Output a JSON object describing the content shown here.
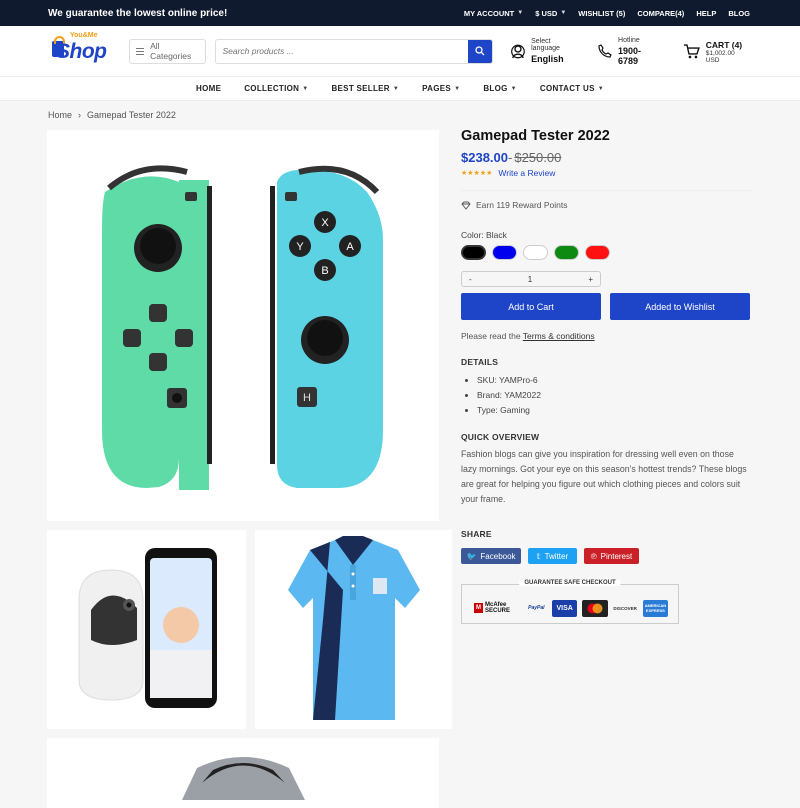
{
  "topbar": {
    "promo": "We guarantee the lowest online price!",
    "links": [
      "MY ACCOUNT",
      "$ USD",
      "WISHLIST (5)",
      "COMPARE(4)",
      "HELP",
      "BLOG"
    ]
  },
  "header": {
    "logo_top": "You&Me",
    "logo_main": "Shop",
    "categories_label": "All Categories",
    "search_placeholder": "Search products ...",
    "language_label": "Select language",
    "language_value": "English",
    "hotline_label": "Hotline",
    "hotline_value": "1900-6789",
    "cart_label": "CART (4)",
    "cart_total": "$1,002.00 USD"
  },
  "nav": [
    "HOME",
    "COLLECTION",
    "BEST SELLER",
    "PAGES",
    "BLOG",
    "CONTACT US"
  ],
  "breadcrumb": {
    "home": "Home",
    "current": "Gamepad Tester 2022"
  },
  "product": {
    "title": "Gamepad Tester 2022",
    "price": "$238.00",
    "old_price": "$250.00",
    "stars": "★★★★★",
    "review_link": "Write a Review",
    "reward": "Earn 119 Reward Points",
    "color_label": "Color: Black",
    "swatches": [
      "#000000",
      "#0000ee",
      "#ffffff",
      "#0c8a12",
      "#ff1111"
    ],
    "qty_minus": "-",
    "qty_value": "1",
    "qty_plus": "+",
    "add_to_cart": "Add to Cart",
    "add_to_wishlist": "Added to Wishlist",
    "terms_prefix": "Please read the",
    "terms_link": "Terms & conditions",
    "details_heading": "DETAILS",
    "details": [
      "SKU: YAMPro-6",
      "Brand: YAM2022",
      "Type: Gaming"
    ],
    "overview_heading": "QUICK OVERVIEW",
    "overview": "Fashion blogs can give you inspiration for dressing well even on those lazy mornings. Got your eye on this season's hottest trends? These blogs are great for helping you figure out which clothing pieces and colors suit your frame.",
    "share_heading": "SHARE",
    "share": [
      {
        "label": "Facebook",
        "color": "#3b5998"
      },
      {
        "label": "Twitter",
        "color": "#1da1f2"
      },
      {
        "label": "Pinterest",
        "color": "#cb2027"
      }
    ],
    "guarantee_label": "GUARANTEE SAFE CHECKOUT",
    "payment_badges": [
      "McAfee SECURE",
      "PayPal",
      "VISA",
      "MasterCard",
      "DISCOVER",
      "AMERICAN EXPRESS"
    ]
  },
  "joycon_buttons": [
    "X",
    "Y",
    "A",
    "B",
    "H"
  ],
  "colors": {
    "accent": "#1e44c8",
    "topbar": "#0f1a2e",
    "joycon_left": "#5fdba8",
    "joycon_right": "#5cd3e3"
  }
}
